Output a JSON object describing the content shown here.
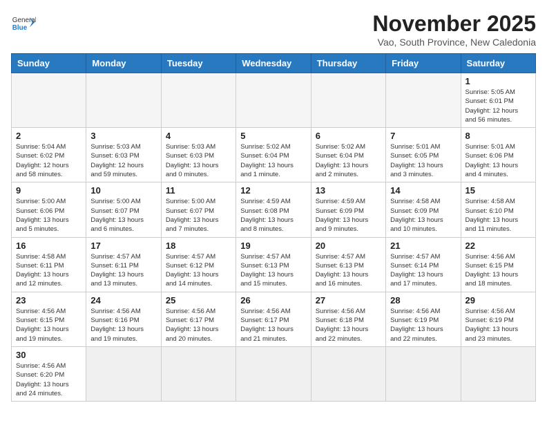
{
  "header": {
    "logo_general": "General",
    "logo_blue": "Blue",
    "month_title": "November 2025",
    "location": "Vao, South Province, New Caledonia"
  },
  "weekdays": [
    "Sunday",
    "Monday",
    "Tuesday",
    "Wednesday",
    "Thursday",
    "Friday",
    "Saturday"
  ],
  "weeks": [
    [
      {
        "day": "",
        "info": ""
      },
      {
        "day": "",
        "info": ""
      },
      {
        "day": "",
        "info": ""
      },
      {
        "day": "",
        "info": ""
      },
      {
        "day": "",
        "info": ""
      },
      {
        "day": "",
        "info": ""
      },
      {
        "day": "1",
        "info": "Sunrise: 5:05 AM\nSunset: 6:01 PM\nDaylight: 12 hours\nand 56 minutes."
      }
    ],
    [
      {
        "day": "2",
        "info": "Sunrise: 5:04 AM\nSunset: 6:02 PM\nDaylight: 12 hours\nand 58 minutes."
      },
      {
        "day": "3",
        "info": "Sunrise: 5:03 AM\nSunset: 6:03 PM\nDaylight: 12 hours\nand 59 minutes."
      },
      {
        "day": "4",
        "info": "Sunrise: 5:03 AM\nSunset: 6:03 PM\nDaylight: 13 hours\nand 0 minutes."
      },
      {
        "day": "5",
        "info": "Sunrise: 5:02 AM\nSunset: 6:04 PM\nDaylight: 13 hours\nand 1 minute."
      },
      {
        "day": "6",
        "info": "Sunrise: 5:02 AM\nSunset: 6:04 PM\nDaylight: 13 hours\nand 2 minutes."
      },
      {
        "day": "7",
        "info": "Sunrise: 5:01 AM\nSunset: 6:05 PM\nDaylight: 13 hours\nand 3 minutes."
      },
      {
        "day": "8",
        "info": "Sunrise: 5:01 AM\nSunset: 6:06 PM\nDaylight: 13 hours\nand 4 minutes."
      }
    ],
    [
      {
        "day": "9",
        "info": "Sunrise: 5:00 AM\nSunset: 6:06 PM\nDaylight: 13 hours\nand 5 minutes."
      },
      {
        "day": "10",
        "info": "Sunrise: 5:00 AM\nSunset: 6:07 PM\nDaylight: 13 hours\nand 6 minutes."
      },
      {
        "day": "11",
        "info": "Sunrise: 5:00 AM\nSunset: 6:07 PM\nDaylight: 13 hours\nand 7 minutes."
      },
      {
        "day": "12",
        "info": "Sunrise: 4:59 AM\nSunset: 6:08 PM\nDaylight: 13 hours\nand 8 minutes."
      },
      {
        "day": "13",
        "info": "Sunrise: 4:59 AM\nSunset: 6:09 PM\nDaylight: 13 hours\nand 9 minutes."
      },
      {
        "day": "14",
        "info": "Sunrise: 4:58 AM\nSunset: 6:09 PM\nDaylight: 13 hours\nand 10 minutes."
      },
      {
        "day": "15",
        "info": "Sunrise: 4:58 AM\nSunset: 6:10 PM\nDaylight: 13 hours\nand 11 minutes."
      }
    ],
    [
      {
        "day": "16",
        "info": "Sunrise: 4:58 AM\nSunset: 6:11 PM\nDaylight: 13 hours\nand 12 minutes."
      },
      {
        "day": "17",
        "info": "Sunrise: 4:57 AM\nSunset: 6:11 PM\nDaylight: 13 hours\nand 13 minutes."
      },
      {
        "day": "18",
        "info": "Sunrise: 4:57 AM\nSunset: 6:12 PM\nDaylight: 13 hours\nand 14 minutes."
      },
      {
        "day": "19",
        "info": "Sunrise: 4:57 AM\nSunset: 6:13 PM\nDaylight: 13 hours\nand 15 minutes."
      },
      {
        "day": "20",
        "info": "Sunrise: 4:57 AM\nSunset: 6:13 PM\nDaylight: 13 hours\nand 16 minutes."
      },
      {
        "day": "21",
        "info": "Sunrise: 4:57 AM\nSunset: 6:14 PM\nDaylight: 13 hours\nand 17 minutes."
      },
      {
        "day": "22",
        "info": "Sunrise: 4:56 AM\nSunset: 6:15 PM\nDaylight: 13 hours\nand 18 minutes."
      }
    ],
    [
      {
        "day": "23",
        "info": "Sunrise: 4:56 AM\nSunset: 6:15 PM\nDaylight: 13 hours\nand 19 minutes."
      },
      {
        "day": "24",
        "info": "Sunrise: 4:56 AM\nSunset: 6:16 PM\nDaylight: 13 hours\nand 19 minutes."
      },
      {
        "day": "25",
        "info": "Sunrise: 4:56 AM\nSunset: 6:17 PM\nDaylight: 13 hours\nand 20 minutes."
      },
      {
        "day": "26",
        "info": "Sunrise: 4:56 AM\nSunset: 6:17 PM\nDaylight: 13 hours\nand 21 minutes."
      },
      {
        "day": "27",
        "info": "Sunrise: 4:56 AM\nSunset: 6:18 PM\nDaylight: 13 hours\nand 22 minutes."
      },
      {
        "day": "28",
        "info": "Sunrise: 4:56 AM\nSunset: 6:19 PM\nDaylight: 13 hours\nand 22 minutes."
      },
      {
        "day": "29",
        "info": "Sunrise: 4:56 AM\nSunset: 6:19 PM\nDaylight: 13 hours\nand 23 minutes."
      }
    ],
    [
      {
        "day": "30",
        "info": "Sunrise: 4:56 AM\nSunset: 6:20 PM\nDaylight: 13 hours\nand 24 minutes."
      },
      {
        "day": "",
        "info": ""
      },
      {
        "day": "",
        "info": ""
      },
      {
        "day": "",
        "info": ""
      },
      {
        "day": "",
        "info": ""
      },
      {
        "day": "",
        "info": ""
      },
      {
        "day": "",
        "info": ""
      }
    ]
  ]
}
